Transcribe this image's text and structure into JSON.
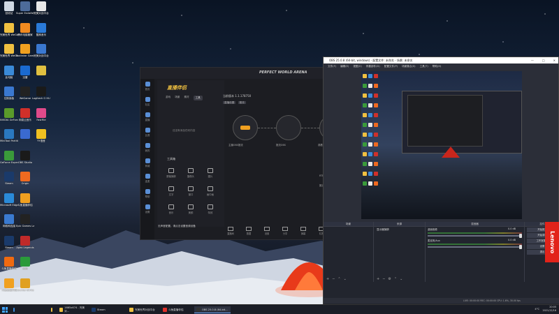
{
  "desktop": {
    "icons": [
      {
        "label": "回收站",
        "color": "#cfd8e3"
      },
      {
        "label": "Super Endsfield",
        "color": "#4d6b9a"
      },
      {
        "label": "完美对战平台",
        "color": "#e8e8e8"
      },
      {
        "label": "完美世界 WeGame版",
        "color": "#f0c040"
      },
      {
        "label": "腾讯电脑管家",
        "color": "#f08a20"
      },
      {
        "label": "酷狗音乐",
        "color": "#2a7ad8"
      },
      {
        "label": "完美世界 WeGame版",
        "color": "#f0c040"
      },
      {
        "label": "Rockstar Games...",
        "color": "#f0a020"
      },
      {
        "label": "完美对战平台",
        "color": "#3a78d0"
      },
      {
        "label": "此电脑",
        "color": "#3a8ad8"
      },
      {
        "label": "迅雷",
        "color": "#1a6ad0"
      },
      {
        "label": "",
        "color": "#e0c040"
      },
      {
        "label": "控制面板",
        "color": "#3a78d0"
      },
      {
        "label": "WeGame",
        "color": "#222"
      },
      {
        "label": "Logitech G HUB",
        "color": "#1a1a1a"
      },
      {
        "label": "NVIDIA GeForce",
        "color": "#5a9a2a"
      },
      {
        "label": "网易云音乐",
        "color": "#d0302a"
      },
      {
        "label": "FastFile",
        "color": "#e04a8a"
      },
      {
        "label": "MiniTool Partition",
        "color": "#2a78c0"
      },
      {
        "label": "",
        "color": "#3a6ad0"
      },
      {
        "label": "YY语音",
        "color": "#f0c020"
      },
      {
        "label": "GeForce Experience",
        "color": "#3a9a3a"
      },
      {
        "label": "OBS Studio",
        "color": "#1a1a1a"
      },
      {
        "label": "",
        "color": ""
      },
      {
        "label": "Steam",
        "color": "#1a3a6a"
      },
      {
        "label": "Origin",
        "color": "#f06a20"
      },
      {
        "label": "",
        "color": ""
      },
      {
        "label": "Microsoft Edge",
        "color": "#2a8ad8"
      },
      {
        "label": "斗鱼直播伴侣",
        "color": "#f0a020"
      },
      {
        "label": "",
        "color": ""
      },
      {
        "label": "网络和连接",
        "color": "#3a7ad0"
      },
      {
        "label": "Epic Games Launcher",
        "color": "#222"
      },
      {
        "label": "",
        "color": ""
      },
      {
        "label": "Steam",
        "color": "#1a3a6a"
      },
      {
        "label": "Apex Legends",
        "color": "#c02a2a"
      },
      {
        "label": "",
        "color": ""
      },
      {
        "label": "斗鱼直播伴侣",
        "color": "#f06a10"
      },
      {
        "label": "微信",
        "color": "#2a9a3a"
      },
      {
        "label": "",
        "color": ""
      },
      {
        "label": "斗鱼直播伴侣",
        "color": "#f0a020"
      },
      {
        "label": "Counter-Strike Global Off...",
        "color": "#e0a020"
      },
      {
        "label": "",
        "color": ""
      }
    ]
  },
  "pwa": {
    "brand": "PERFECT WORLD ARENA",
    "logo": "直播伴侣",
    "sidebar": [
      "首页",
      "社区",
      "直播",
      "比赛",
      "我的",
      "商城",
      "连麦",
      "帮助",
      "设置"
    ],
    "tabs": [
      "游戏",
      "场景",
      "素材",
      "工具"
    ],
    "empty_text": "还没有添加任何内容",
    "tools_title": "工具箱",
    "tools": [
      "屏幕捕获",
      "摄像头",
      "图片",
      "文字",
      "窗口",
      "画中画",
      "音乐",
      "美颜",
      "特效"
    ],
    "version": "当前版本 1.1.178750",
    "sub_items": [
      "直播设置",
      "推流"
    ],
    "obs_label": "OBS第三方推流模式",
    "node_labels": [
      "主播OBS推流",
      "推流OBS",
      "观看直播"
    ],
    "field_labels": [
      "RTMP地址",
      "推流码"
    ],
    "field_values": [
      "•••••••••••••••••",
      "•••••••••••••••••"
    ],
    "bottom_buttons": [
      "直播间",
      "数据",
      "设置",
      "分享",
      "弹幕",
      "礼物"
    ],
    "status_text": "无声音配置，请点击设置音频设备"
  },
  "obs": {
    "title": "OBS 25.0.8 (64-bit, windows) - 配置文件: 未命名 - 场景: 未命名",
    "menu": [
      "文件(F)",
      "编辑(E)",
      "视图(V)",
      "停靠部件(D)",
      "配置文件(P)",
      "场景集合(S)",
      "工具(T)",
      "帮助(H)"
    ],
    "docks": {
      "scenes": "场景",
      "sources": "来源",
      "mixer": "混音器",
      "controls": "控件"
    },
    "source_item": "显示器捕获",
    "mixer": [
      {
        "name": "桌面音频",
        "db": "0.0 dB"
      },
      {
        "name": "麦克风/Aux",
        "db": "0.0 dB"
      }
    ],
    "controls": [
      "开始推流",
      "开始录制",
      "工作室模式",
      "设置",
      "退出"
    ],
    "status": "LIVE: 00:00:00   REC: 00:00:00   CPU: 1.6%, 30.00 fps"
  },
  "lenovo": "Lenovo",
  "taskbar": {
    "items": [
      {
        "label": "",
        "color": "#3a8ad8"
      },
      {
        "label": "",
        "color": "#f0c040"
      },
      {
        "label": "1665x674 - 完美对...",
        "color": "#f0c040"
      },
      {
        "label": "Steam",
        "color": "#1a3a6a"
      },
      {
        "label": "完美世界对战平台",
        "color": "#f0c040"
      },
      {
        "label": "斗鱼直播伴侣",
        "color": "#e0302a"
      },
      {
        "label": "OBS 25.0.8 (64-bit...",
        "color": "#333"
      }
    ],
    "temp": "4°C",
    "time": "20:05",
    "date": "2021/12/16"
  }
}
